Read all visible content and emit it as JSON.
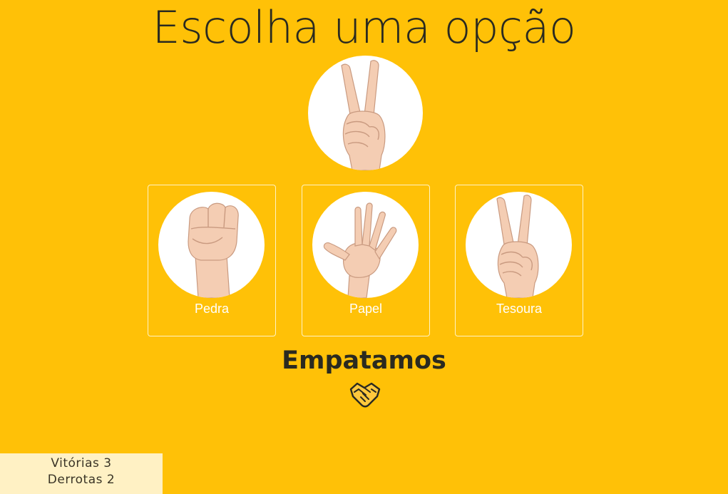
{
  "page": {
    "title": "Escolha uma opção",
    "background_color": "#FFC107"
  },
  "computer_choice": {
    "icon": "scissors-hand-icon"
  },
  "options": [
    {
      "label": "Pedra",
      "icon": "rock-fist-icon"
    },
    {
      "label": "Papel",
      "icon": "paper-open-hand-icon"
    },
    {
      "label": "Tesoura",
      "icon": "scissors-hand-icon"
    }
  ],
  "result": {
    "text": "Empatamos",
    "icon": "handshake-icon"
  },
  "score": {
    "wins_text": "Vitórias 3",
    "losses_text": "Derrotas 2"
  }
}
